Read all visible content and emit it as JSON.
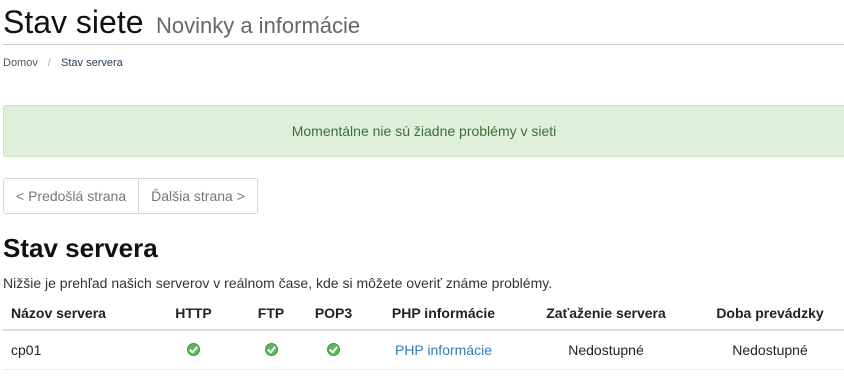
{
  "header": {
    "title": "Stav siete",
    "subtitle": "Novinky a informácie"
  },
  "breadcrumb": {
    "home": "Domov",
    "separator": "/",
    "current": "Stav servera"
  },
  "alert": {
    "message": "Momentálne nie sú žiadne problémy v sieti"
  },
  "pager": {
    "prev": "< Predošlá strana",
    "next": "Ďalšia strana >"
  },
  "section": {
    "title": "Stav servera",
    "description": "Nižšie je prehľad našich serverov v reálnom čase, kde si môžete overiť známe problémy."
  },
  "table": {
    "columns": [
      "Názov servera",
      "HTTP",
      "FTP",
      "POP3",
      "PHP informácie",
      "Zaťaženie servera",
      "Doba prevádzky"
    ],
    "rows": [
      {
        "name": "cp01",
        "http": "ok-icon",
        "ftp": "ok-icon",
        "pop3": "ok-icon",
        "php": "PHP informácie",
        "load": "Nedostupné",
        "uptime": "Nedostupné"
      }
    ]
  },
  "colors": {
    "alert_bg": "#dff0d8",
    "alert_text": "#3c6e3a",
    "link": "#337ab7",
    "ok": "#5cb85c"
  }
}
